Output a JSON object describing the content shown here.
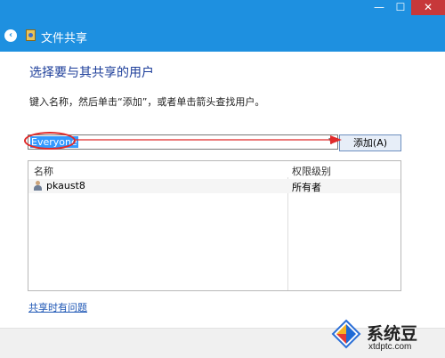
{
  "window": {
    "title": "文件共享",
    "controls": {
      "minimize": "—",
      "maximize": "☐",
      "close": "✕"
    }
  },
  "nav": {
    "back_icon": "back-arrow-icon",
    "back_glyph": "‹"
  },
  "main": {
    "heading": "选择要与其共享的用户",
    "instruction": "键入名称，然后单击“添加”，或者单击箭头查找用户。",
    "name_input": {
      "value": "Everyone"
    },
    "add_button_label": "添加(A)"
  },
  "table": {
    "columns": [
      "名称",
      "权限级别"
    ],
    "rows": [
      {
        "name": "pkaust8",
        "permission": "所有者"
      }
    ]
  },
  "links": {
    "help": "共享时有问题"
  },
  "watermark": {
    "title": "系统豆",
    "url": "xtdptc.com"
  },
  "colors": {
    "accent": "#1e90e0",
    "annotation": "#e02a2a",
    "heading": "#1d3e9a"
  }
}
